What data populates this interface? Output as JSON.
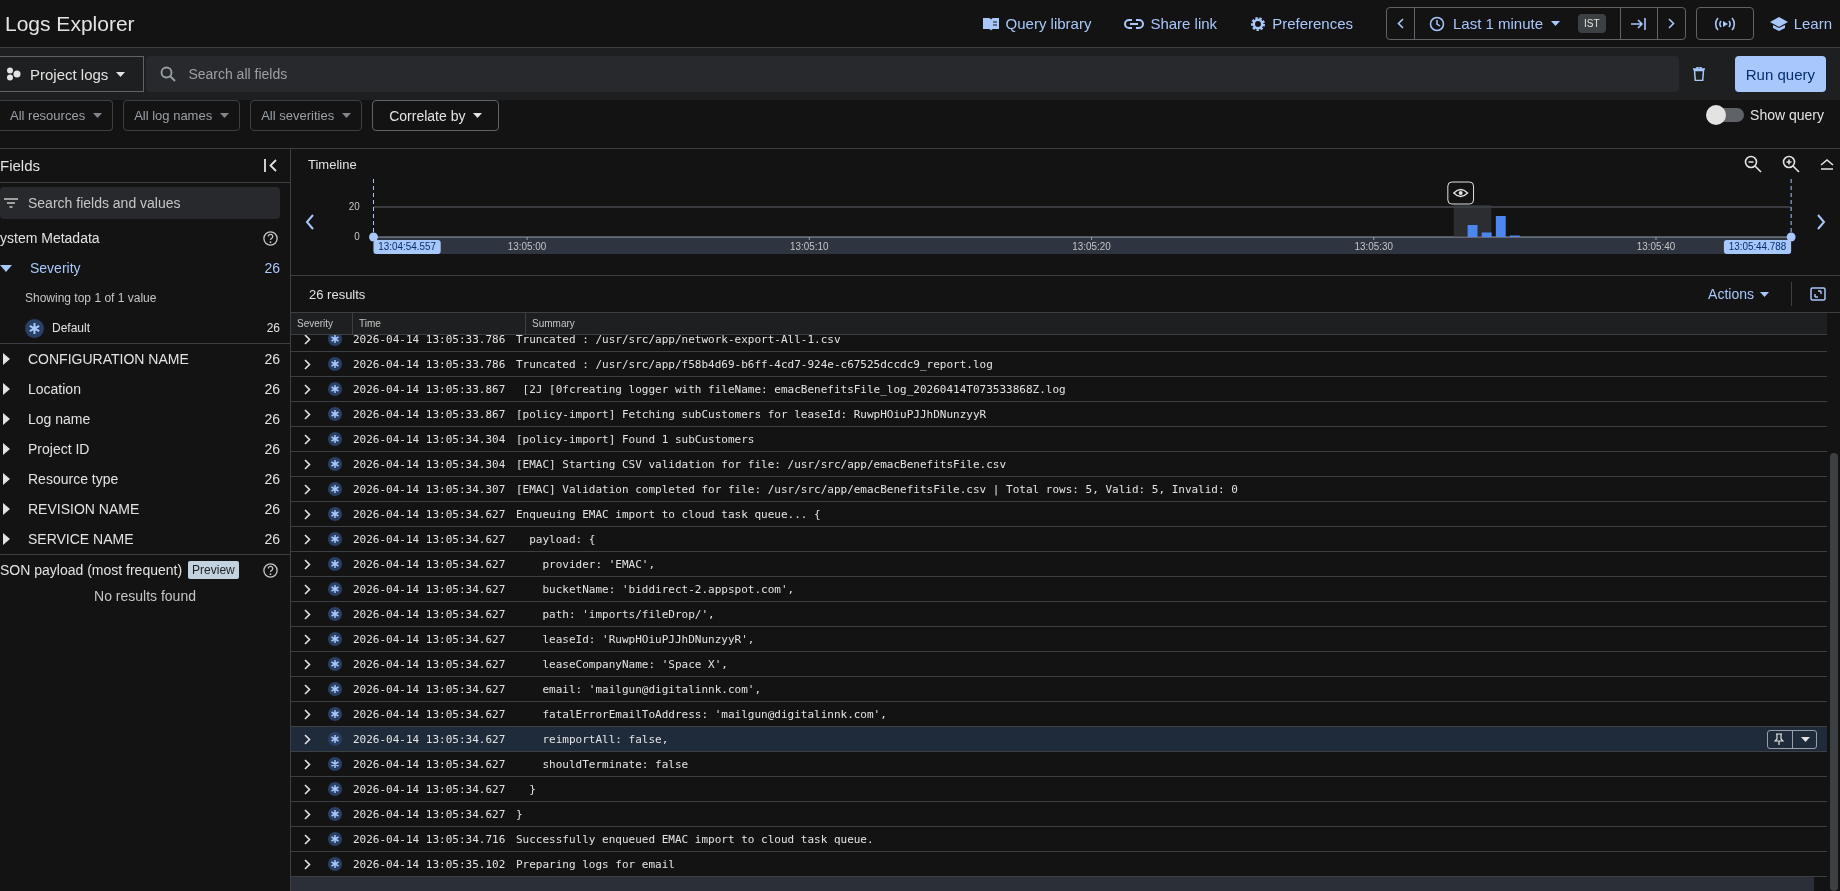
{
  "header": {
    "title": "Logs Explorer",
    "links": [
      "Query library",
      "Share link",
      "Preferences"
    ],
    "time_range": "Last 1 minute",
    "timezone": "IST",
    "learn": "Learn"
  },
  "query": {
    "scope": "Project logs",
    "placeholder": "Search all fields",
    "run": "Run query",
    "filters": [
      {
        "label": "All resources",
        "kind": "filter"
      },
      {
        "label": "All log names",
        "kind": "filter"
      },
      {
        "label": "All severities",
        "kind": "filter"
      },
      {
        "label": "Correlate by",
        "kind": "menu"
      }
    ],
    "show_query": {
      "label": "Show query",
      "on": false
    }
  },
  "fields": {
    "title": "Fields",
    "placeholder": "Search fields and values",
    "section": "ystem Metadata",
    "items": [
      {
        "label": "Severity",
        "count": "26",
        "expanded": true,
        "summary": "Showing top 1 of 1 value",
        "values": [
          {
            "label": "Default",
            "count": "26"
          }
        ]
      },
      {
        "label": "CONFIGURATION NAME",
        "count": "26",
        "expanded": false
      },
      {
        "label": "Location",
        "count": "26",
        "expanded": false
      },
      {
        "label": "Log name",
        "count": "26",
        "expanded": false
      },
      {
        "label": "Project ID",
        "count": "26",
        "expanded": false
      },
      {
        "label": "Resource type",
        "count": "26",
        "expanded": false
      },
      {
        "label": "REVISION NAME",
        "count": "26",
        "expanded": false
      },
      {
        "label": "SERVICE NAME",
        "count": "26",
        "expanded": false
      }
    ],
    "payload": {
      "title": "SON payload (most frequent)",
      "badge": "Preview",
      "empty": "No results found"
    }
  },
  "timeline": {
    "title": "Timeline",
    "range_start": "13:04:54.557",
    "range_end": "13:05:44.788",
    "chart_data": {
      "type": "bar",
      "x": [
        47133.5,
        47134.0,
        47134.5,
        47135.0
      ],
      "values": [
        8,
        3,
        14,
        1
      ],
      "xlim": [
        47094.557,
        47144.788
      ],
      "ylim": [
        0,
        20
      ],
      "yticks": [
        0,
        20
      ],
      "xticks": [
        {
          "value": 47100,
          "label": "13:05:00"
        },
        {
          "value": 47110,
          "label": "13:05:10"
        },
        {
          "value": 47120,
          "label": "13:05:20"
        },
        {
          "value": 47130,
          "label": "13:05:30"
        },
        {
          "value": 47140,
          "label": "13:05:40"
        }
      ]
    }
  },
  "results": {
    "count": "26 results",
    "actions": "Actions",
    "columns": [
      "Severity",
      "Time",
      "Summary"
    ],
    "rows": [
      {
        "time": "2026-04-14 13:05:33.786",
        "summary": "Truncated : /usr/src/app/network-export-All-1.csv",
        "selected": false
      },
      {
        "time": "2026-04-14 13:05:33.786",
        "summary": "Truncated : /usr/src/app/f58b4d69-b6ff-4cd7-924e-c67525dccdc9_report.log",
        "selected": false
      },
      {
        "time": "2026-04-14 13:05:33.867",
        "summary": " [2J [0fcreating logger with fileName: emacBenefitsFile_log_20260414T073533868Z.log",
        "selected": false
      },
      {
        "time": "2026-04-14 13:05:33.867",
        "summary": "[policy-import] Fetching subCustomers for leaseId: RuwpHOiuPJJhDNunzyyR",
        "selected": false
      },
      {
        "time": "2026-04-14 13:05:34.304",
        "summary": "[policy-import] Found 1 subCustomers",
        "selected": false
      },
      {
        "time": "2026-04-14 13:05:34.304",
        "summary": "[EMAC] Starting CSV validation for file: /usr/src/app/emacBenefitsFile.csv",
        "selected": false
      },
      {
        "time": "2026-04-14 13:05:34.307",
        "summary": "[EMAC] Validation completed for file: /usr/src/app/emacBenefitsFile.csv | Total rows: 5, Valid: 5, Invalid: 0",
        "selected": false
      },
      {
        "time": "2026-04-14 13:05:34.627",
        "summary": "Enqueuing EMAC import to cloud task queue... {",
        "selected": false
      },
      {
        "time": "2026-04-14 13:05:34.627",
        "summary": "  payload: {",
        "selected": false
      },
      {
        "time": "2026-04-14 13:05:34.627",
        "summary": "    provider: 'EMAC',",
        "selected": false
      },
      {
        "time": "2026-04-14 13:05:34.627",
        "summary": "    bucketName: 'biddirect-2.appspot.com',",
        "selected": false
      },
      {
        "time": "2026-04-14 13:05:34.627",
        "summary": "    path: 'imports/fileDrop/',",
        "selected": false
      },
      {
        "time": "2026-04-14 13:05:34.627",
        "summary": "    leaseId: 'RuwpHOiuPJJhDNunzyyR',",
        "selected": false
      },
      {
        "time": "2026-04-14 13:05:34.627",
        "summary": "    leaseCompanyName: 'Space X',",
        "selected": false
      },
      {
        "time": "2026-04-14 13:05:34.627",
        "summary": "    email: 'mailgun@digitalinnk.com',",
        "selected": false
      },
      {
        "time": "2026-04-14 13:05:34.627",
        "summary": "    fatalErrorEmailToAddress: 'mailgun@digitalinnk.com',",
        "selected": false
      },
      {
        "time": "2026-04-14 13:05:34.627",
        "summary": "    reimportAll: false,",
        "selected": true
      },
      {
        "time": "2026-04-14 13:05:34.627",
        "summary": "    shouldTerminate: false",
        "selected": false
      },
      {
        "time": "2026-04-14 13:05:34.627",
        "summary": "  }",
        "selected": false
      },
      {
        "time": "2026-04-14 13:05:34.627",
        "summary": "}",
        "selected": false
      },
      {
        "time": "2026-04-14 13:05:34.716",
        "summary": "Successfully enqueued EMAC import to cloud task queue.",
        "selected": false
      },
      {
        "time": "2026-04-14 13:05:35.102",
        "summary": "Preparing logs for email",
        "selected": false
      }
    ]
  }
}
